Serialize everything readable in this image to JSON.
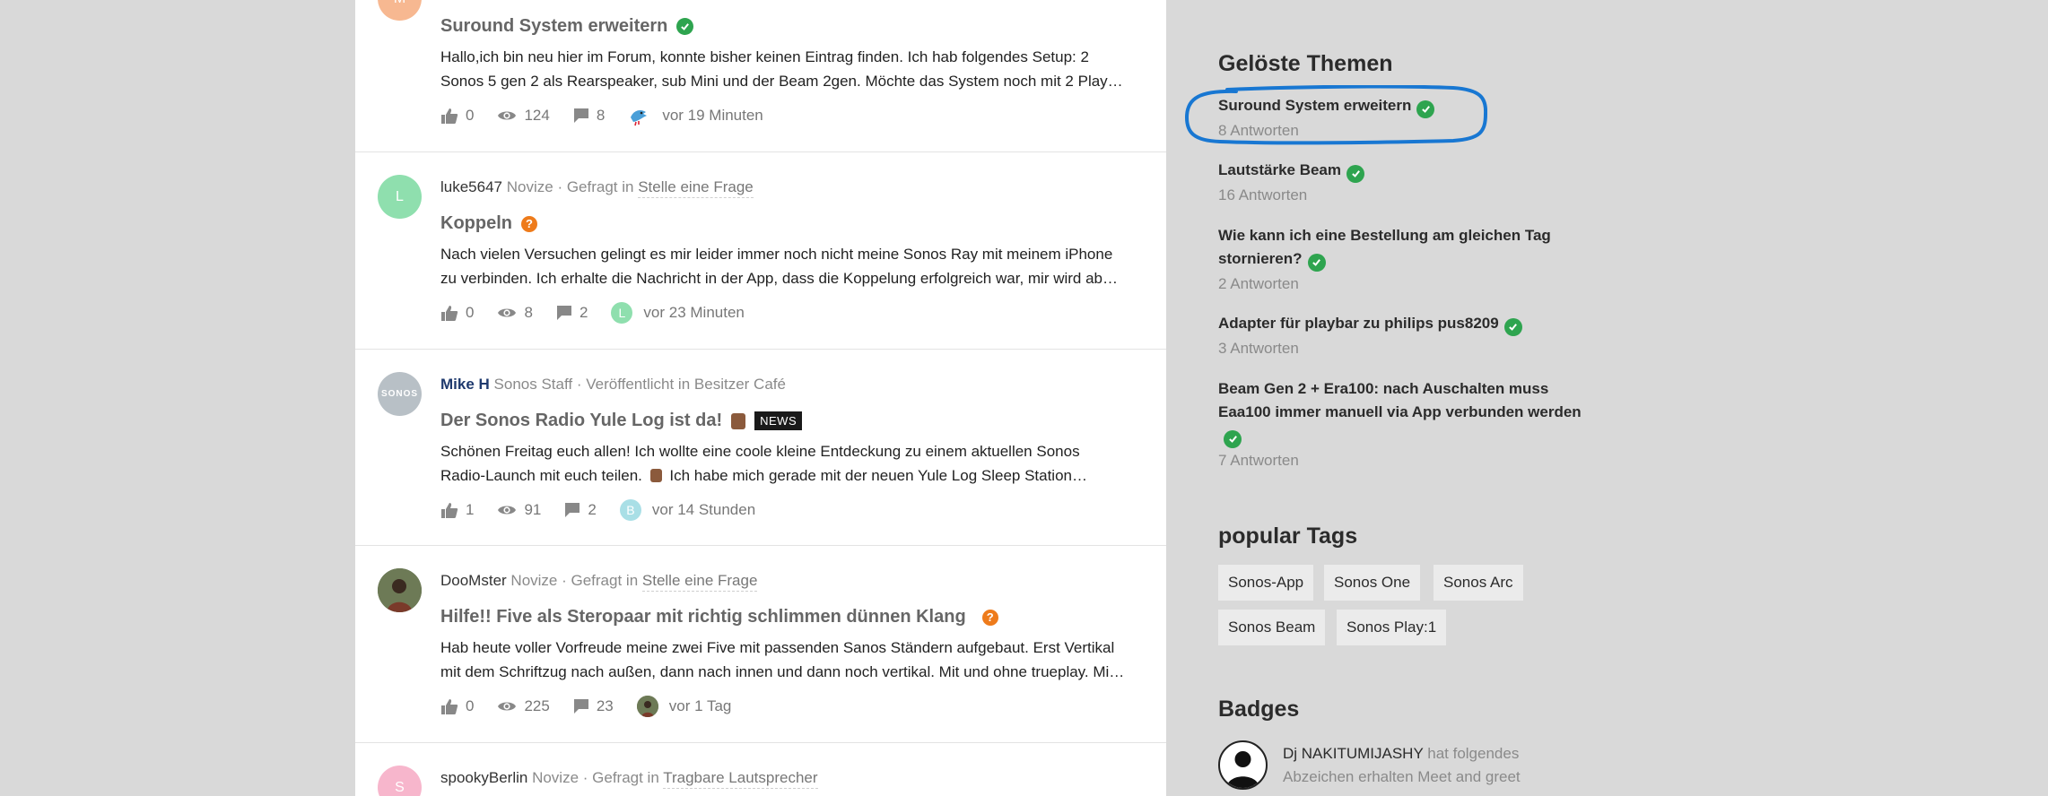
{
  "feed": {
    "posts": [
      {
        "title": "Suround System erweitern",
        "title_status": "solved",
        "excerpt": [
          "Hallo,ich bin neu hier im Forum, konnte bisher keinen Eintrag finden. Ich hab folgendes Setup: 2",
          "Sonos 5 gen 2 als Rearspeaker, sub Mini und der Beam 2gen. Möchte das System noch mit 2 Play…"
        ],
        "likes": "0",
        "views": "124",
        "replies": "8",
        "last_activity": "vor 19 Minuten",
        "avatar_letter": "M",
        "avatar_color": "#f7b891"
      },
      {
        "user": "luke5647",
        "rank": "Novize",
        "action": "Gefragt in",
        "category": "Stelle eine Frage",
        "title": "Koppeln",
        "title_status": "question",
        "excerpt": [
          "Nach vielen Versuchen gelingt es mir leider immer noch nicht meine Sonos Ray mit meinem iPhone",
          "zu verbinden. Ich erhalte die Nachricht in der App, dass die Koppelung erfolgreich war, mir wird ab…"
        ],
        "likes": "0",
        "views": "8",
        "replies": "2",
        "last_activity": "vor 23 Minuten",
        "avatar_letter": "L",
        "avatar_color": "#8fdfae",
        "last_avatar_letter": "L"
      },
      {
        "user": "Mike H",
        "rank": "Sonos Staff",
        "action": "Veröffentlicht in",
        "category": "Besitzer Café",
        "title": "Der Sonos Radio Yule Log ist da!",
        "badge": "NEWS",
        "excerpt": [
          "Schönen Freitag euch allen! Ich wollte eine coole kleine Entdeckung zu einem aktuellen Sonos",
          "Radio-Launch mit euch teilen.",
          "Ich habe mich gerade mit der neuen Yule Log Sleep Station…"
        ],
        "likes": "1",
        "views": "91",
        "replies": "2",
        "last_activity": "vor 14 Stunden",
        "avatar_text": "SONOS",
        "last_avatar_letter": "B"
      },
      {
        "user": "DooMster",
        "rank": "Novize",
        "action": "Gefragt in",
        "category": "Stelle eine Frage",
        "title": "Hilfe!! Five als Steropaar mit richtig schlimmen dünnen Klang",
        "title_status": "question",
        "excerpt": [
          "Hab heute voller Vorfreude meine zwei Five mit passenden Sanos Ständern aufgebaut. Erst Vertikal",
          "mit dem Schriftzug nach außen, dann nach innen und dann noch vertikal. Mit und ohne trueplay. Mi…"
        ],
        "likes": "0",
        "views": "225",
        "replies": "23",
        "last_activity": "vor 1 Tag"
      },
      {
        "user": "spookyBerlin",
        "rank": "Novize",
        "action": "Gefragt in",
        "category": "Tragbare Lautsprecher",
        "avatar_letter": "S",
        "avatar_color": "#f7b6cc"
      }
    ]
  },
  "sidebar": {
    "solved_heading": "Gelöste Themen",
    "solved": [
      {
        "title": "Suround System erweitern",
        "count": "8 Antworten"
      },
      {
        "title": "Lautstärke Beam",
        "count": "16 Antworten"
      },
      {
        "title": "Wie kann ich eine Bestellung am gleichen Tag stornieren?",
        "count": "2 Antworten"
      },
      {
        "title": "Adapter für playbar zu philips pus8209",
        "count": "3 Antworten"
      },
      {
        "title": "Beam Gen 2 + Era100: nach Auschalten muss Eaa100 immer manuell via App verbunden werden",
        "count": "7 Antworten"
      }
    ],
    "tags_heading": "popular Tags",
    "tags": [
      "Sonos-App",
      "Sonos One",
      "Sonos Arc",
      "Sonos Beam",
      "Sonos Play:1"
    ],
    "badges_heading": "Badges",
    "badge_user": "Dj NAKITUMIJASHY",
    "badge_text": "hat folgendes Abzeichen erhalten Meet and greet"
  },
  "colors": {
    "solved_check": "#2ea44f",
    "question_badge": "#ee7b1b",
    "annotation_stroke": "#1877d2"
  }
}
